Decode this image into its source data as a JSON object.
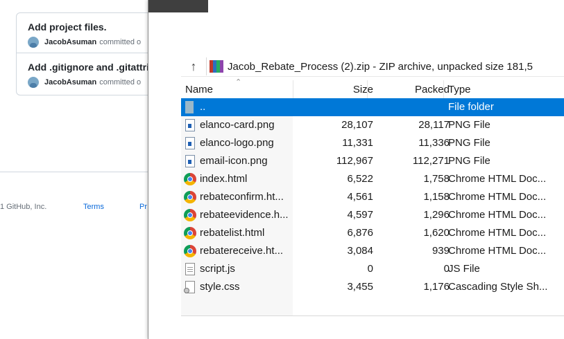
{
  "github": {
    "commits": [
      {
        "title": "Add project files.",
        "author": "JacobAsuman",
        "action": "committed o"
      },
      {
        "title": "Add .gitignore and .gitattrib",
        "author": "JacobAsuman",
        "action": "committed o"
      }
    ],
    "footer": {
      "copyright": "1 GitHub, Inc.",
      "terms": "Terms",
      "privacy": "Pr"
    }
  },
  "window": {
    "path": "Jacob_Rebate_Process (2).zip - ZIP archive, unpacked size 181,5",
    "columns": {
      "name": "Name",
      "size": "Size",
      "packed": "Packed",
      "type": "Type"
    },
    "rows": [
      {
        "name": "..",
        "size": "",
        "packed": "",
        "type": "File folder",
        "icon": "folder-icon",
        "selected": true
      },
      {
        "name": "elanco-card.png",
        "size": "28,107",
        "packed": "28,117",
        "type": "PNG File",
        "icon": "png-file-icon"
      },
      {
        "name": "elanco-logo.png",
        "size": "11,331",
        "packed": "11,336",
        "type": "PNG File",
        "icon": "png-file-icon"
      },
      {
        "name": "email-icon.png",
        "size": "112,967",
        "packed": "112,271",
        "type": "PNG File",
        "icon": "png-file-icon"
      },
      {
        "name": "index.html",
        "size": "6,522",
        "packed": "1,758",
        "type": "Chrome HTML Doc...",
        "icon": "chrome-icon"
      },
      {
        "name": "rebateconfirm.ht...",
        "size": "4,561",
        "packed": "1,158",
        "type": "Chrome HTML Doc...",
        "icon": "chrome-icon"
      },
      {
        "name": "rebateevidence.h...",
        "size": "4,597",
        "packed": "1,296",
        "type": "Chrome HTML Doc...",
        "icon": "chrome-icon"
      },
      {
        "name": "rebatelist.html",
        "size": "6,876",
        "packed": "1,620",
        "type": "Chrome HTML Doc...",
        "icon": "chrome-icon"
      },
      {
        "name": "rebatereceive.ht...",
        "size": "3,084",
        "packed": "939",
        "type": "Chrome HTML Doc...",
        "icon": "chrome-icon"
      },
      {
        "name": "script.js",
        "size": "0",
        "packed": "0",
        "type": "JS File",
        "icon": "js-file-icon"
      },
      {
        "name": "style.css",
        "size": "3,455",
        "packed": "1,176",
        "type": "Cascading Style Sh...",
        "icon": "css-file-icon"
      }
    ]
  },
  "colors": {
    "selection": "#0078d7",
    "link": "#0969da"
  }
}
